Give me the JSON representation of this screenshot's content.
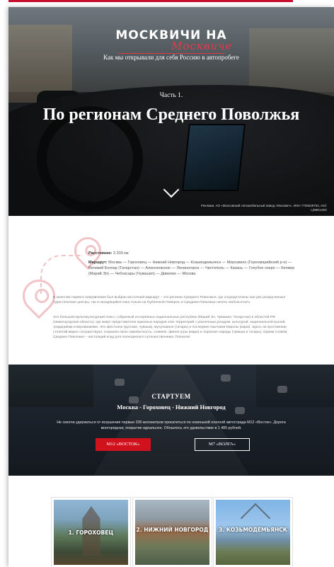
{
  "hero": {
    "logo_main": "МОСКВИЧИ НА",
    "logo_script": "Москвиче",
    "subtitle": "Как мы открывали для себя Россию в автопробеге",
    "part": "Часть 1.",
    "title": "По регионам Среднего Поволжья",
    "credit": "Реклама. АО «Московский Автомобильный Завод «Москвич». ИНН 7705528762, erid: LjN8KxzBX"
  },
  "info": {
    "distance_label": "Расстояние:",
    "distance_value": "3 200 км",
    "route_label": "Маршрут:",
    "route_value": "Москва — Гороховец — Нижний Новгород — Козьмодемьянск — Морозкино (Горномарийский р-н) — Великий Болгар (Татарстан) — Алексеевское — Лениногорск — Чистополь — Казань — Голубое озеро — Кичмер (Марий Эл) — Чебоксары (Чувашия) — Дивеево — Москва",
    "paragraph1": "В качестве первого направления был выбран восточный маршрут – это регионы Среднего Поволжья, где сосредоточены как уже раскрученные туристические центры, так и находящийся пока только на Публичной Поверхн, в Среднем Поволжье ничего любопытного.",
    "paragraph2": "Это большой мультикультурный пласт, собранный из коренных национальных республик (Марий Эл, Чувашия, Татарстан) и областей РФ (Нижегородская область), где живут представители коренных народов этих территорий с различным укладом, культурой, национальной кухней, традициями и верованиями. Это крестьяне (русские, чуваши), мусульмане (татары) и последние язычники Европы (мари). Здесь на протяжении столетий мирно сосуществуют, сохраняя свою самобытность, славяне, финно-угры (мари) и тюркские народы (чуваши и татары). Одним словом, Среднее Поволжье – настоящий клад для полноценного путешественника. Поехали!"
  },
  "start": {
    "heading": "СТАРТУЕМ",
    "route": "Москва - Гороховец - Нижний Новгород",
    "text": "Не смогли удержаться от искушения первые 200 километров прокатиться по новенькой платной автострада М12 «Восток». Дорога многорядная, покрытие идеальное. Обошлось это удовольствие в 1 485 рублей.",
    "btn_m12": "М12 «ВОСТОК»",
    "btn_m7": "М7 «ВОЛГА»"
  },
  "cards": [
    {
      "label": "1. ГОРОХОВЕЦ"
    },
    {
      "label": "2. НИЖНИЙ НОВГОРОД"
    },
    {
      "label": "3. КОЗЬМОДЕМЬЯНСК"
    }
  ],
  "colors": {
    "accent": "#c8102e",
    "button_red": "#d0121d",
    "pin_pink": "#f0c4c8"
  },
  "icons": [
    "chevron-down-icon",
    "map-pin-icon"
  ]
}
